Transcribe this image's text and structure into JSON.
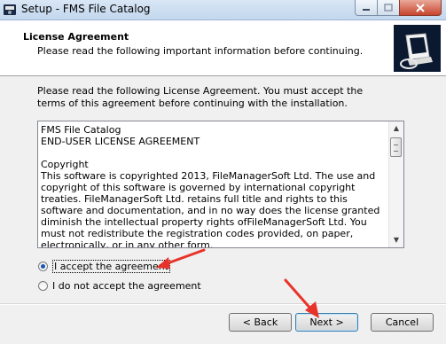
{
  "window": {
    "title": "Setup - FMS File Catalog",
    "minimize_label": "–",
    "maximize_label": "□",
    "close_label": "✕"
  },
  "header": {
    "title": "License Agreement",
    "subtitle": "Please read the following important information before continuing."
  },
  "intro_text": "Please read the following License Agreement. You must accept the terms of this agreement before continuing with the installation.",
  "license": {
    "text": "FMS File Catalog\nEND-USER LICENSE AGREEMENT\n\nCopyright\nThis software is copyrighted 2013, FileManagerSoft Ltd. The use and copyright of this software is governed by international copyright treaties. FileManagerSoft Ltd. retains full title and rights to this software and documentation, and in no way does the license granted diminish the intellectual property rights ofFileManagerSoft Ltd. You must not redistribute the registration codes provided, on paper, electronically, or in any other form."
  },
  "options": {
    "accept_label": "I accept the agreement",
    "decline_label": "I do not accept the agreement",
    "selected": "accept"
  },
  "buttons": {
    "back": "< Back",
    "next": "Next >",
    "cancel": "Cancel"
  },
  "annotation_color": "#e8332a"
}
